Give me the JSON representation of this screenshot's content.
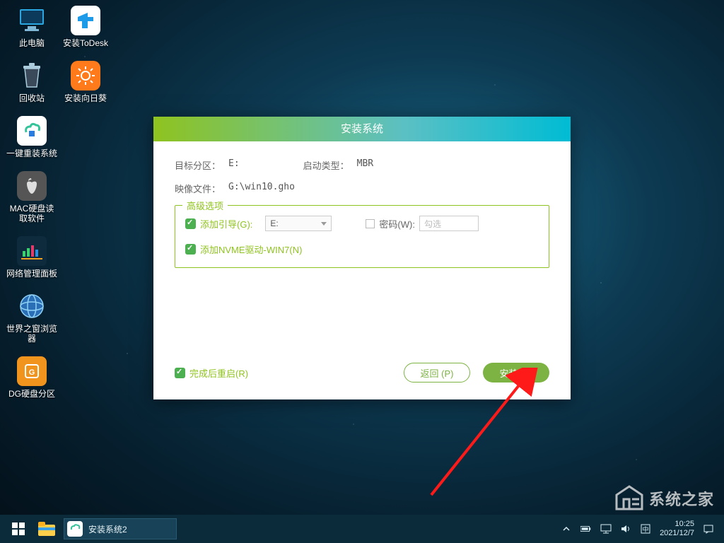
{
  "desktop": {
    "col1": [
      {
        "label": "此电脑"
      },
      {
        "label": "回收站"
      },
      {
        "label": "一键重装系统"
      },
      {
        "label": "MAC硬盘读\n取软件"
      },
      {
        "label": "网络管理面板"
      },
      {
        "label": "世界之窗浏览\n器"
      },
      {
        "label": "DG硬盘分区"
      }
    ],
    "col2": [
      {
        "label": "安装ToDesk"
      },
      {
        "label": "安装向日葵"
      }
    ]
  },
  "dialog": {
    "title": "安装系统",
    "target_partition_lbl": "目标分区：",
    "target_partition_val": "E:",
    "boot_type_lbl": "启动类型：",
    "boot_type_val": "MBR",
    "image_file_lbl": "映像文件：",
    "image_file_val": "G:\\win10.gho",
    "advanced_legend": "高级选项",
    "add_boot_lbl": "添加引导(G):",
    "add_boot_val": "E:",
    "password_lbl": "密码(W):",
    "password_placeholder": "勾选",
    "nvme_lbl": "添加NVME驱动-WIN7(N)",
    "restart_lbl": "完成后重启(R)",
    "back_btn": "返回 (P)",
    "install_btn": "安装 (S)"
  },
  "taskbar": {
    "app_label": "安装系统2",
    "time": "10:25",
    "date": "2021/12/7"
  },
  "watermark": {
    "text": "系统之家"
  }
}
